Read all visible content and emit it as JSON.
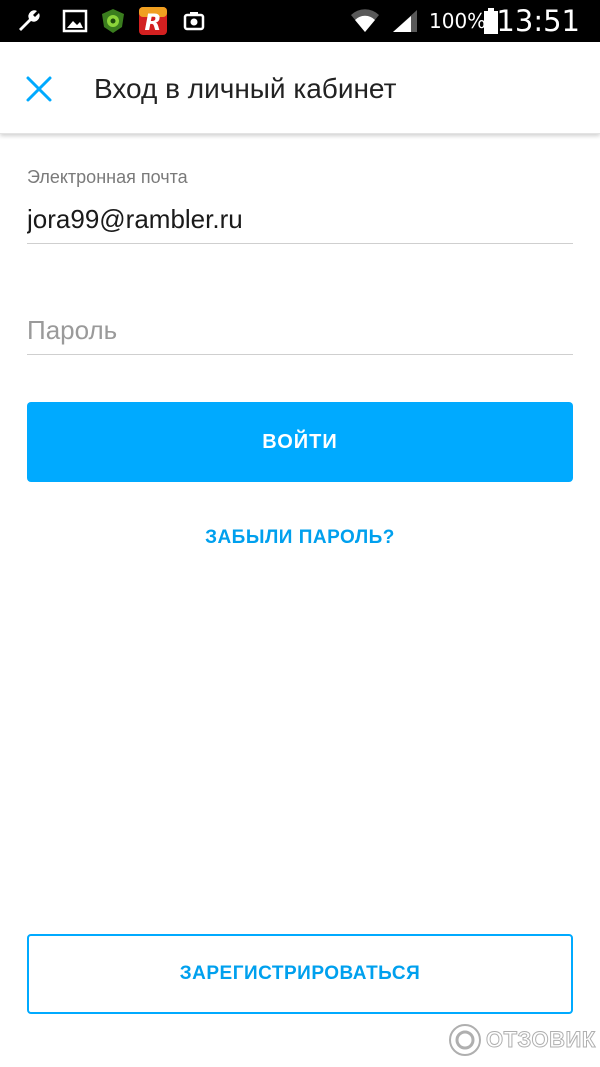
{
  "status_bar": {
    "battery_percent": "100%",
    "time": "13:51",
    "icons": [
      "wrench-icon",
      "gallery-icon",
      "shield-app-icon",
      "r-app-icon",
      "camera-icon",
      "wifi-icon",
      "signal-icon",
      "battery-icon"
    ]
  },
  "app_bar": {
    "close_icon": "close-icon",
    "title": "Вход в личный кабинет"
  },
  "form": {
    "email_label": "Электронная почта",
    "email_value": "jora99@rambler.ru",
    "password_placeholder": "Пароль",
    "login_label": "ВОЙТИ",
    "forgot_label": "ЗАБЫЛИ ПАРОЛЬ?"
  },
  "register_label": "ЗАРЕГИСТРИРОВАТЬСЯ",
  "watermark": "ОТЗОВИК",
  "colors": {
    "accent": "#00aaff",
    "link": "#00a0ee",
    "status_bar": "#000000"
  }
}
